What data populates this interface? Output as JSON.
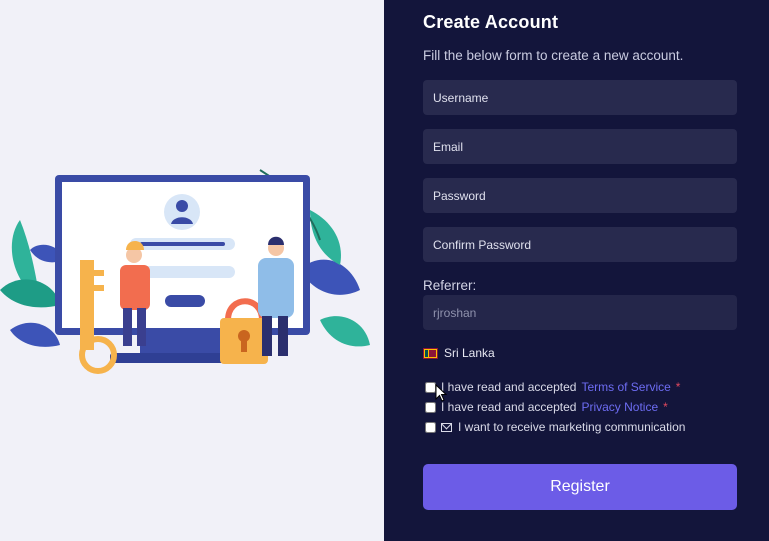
{
  "form": {
    "title": "Create Account",
    "subtitle": "Fill the below form to create a new account.",
    "username_placeholder": "Username",
    "email_placeholder": "Email",
    "password_placeholder": "Password",
    "confirm_password_placeholder": "Confirm Password",
    "referrer_label": "Referrer:",
    "referrer_value": "rjroshan",
    "country": "Sri Lanka",
    "terms": {
      "prefix": "I have read and accepted",
      "link": "Terms of Service",
      "required": "*"
    },
    "privacy": {
      "prefix": "I have read and accepted",
      "link": "Privacy Notice",
      "required": "*"
    },
    "marketing_label": "I want to receive marketing communication",
    "register_label": "Register"
  },
  "colors": {
    "panel_bg": "#13153b",
    "input_bg": "#282a4e",
    "accent": "#6c5ce7",
    "link": "#6d6cf2"
  }
}
